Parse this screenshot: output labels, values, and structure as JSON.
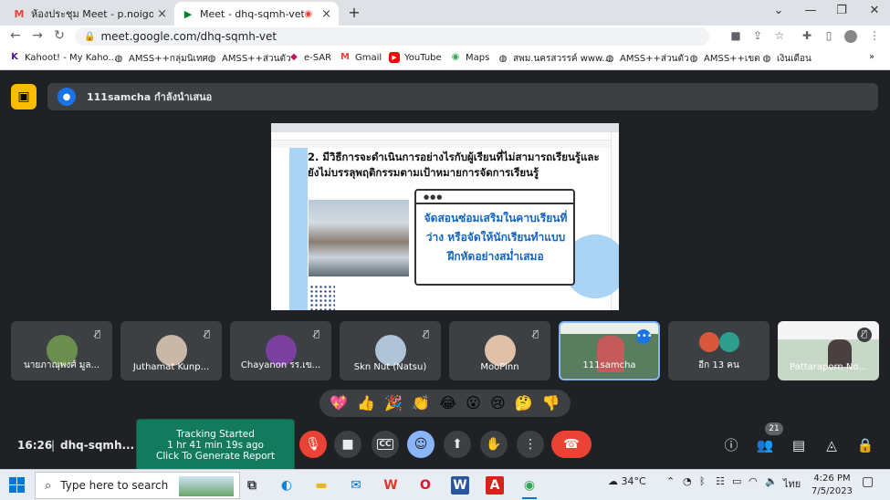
{
  "browser": {
    "tabs": [
      {
        "title": "ห้องประชุม Meet - p.noigor@gmai",
        "icon": "gmail-icon"
      },
      {
        "title": "Meet - dhq-sqmh-vet",
        "icon": "meet-icon",
        "active": true
      }
    ],
    "url": "meet.google.com/dhq-sqmh-vet",
    "bookmarks": [
      {
        "label": "Kahoot! - My Kaho...",
        "icon": "kahoot-icon"
      },
      {
        "label": "AMSS++กลุ่มนิเทศ",
        "icon": "globe-icon"
      },
      {
        "label": "AMSS++ส่วนตัว",
        "icon": "globe-icon"
      },
      {
        "label": "e-SAR",
        "icon": "esar-icon"
      },
      {
        "label": "Gmail",
        "icon": "gmail-icon"
      },
      {
        "label": "YouTube",
        "icon": "youtube-icon"
      },
      {
        "label": "Maps",
        "icon": "maps-icon"
      },
      {
        "label": "สพม.นครสวรรค์ www....",
        "icon": "globe-icon"
      },
      {
        "label": "AMSS++ส่วนตัว",
        "icon": "globe-icon"
      },
      {
        "label": "AMSS++เขต",
        "icon": "globe-icon"
      },
      {
        "label": "เงินเดือน",
        "icon": "globe-icon"
      }
    ],
    "more_bookmarks": "»"
  },
  "meet": {
    "presenter_text": "111samcha กำลังนำเสนอ",
    "slide": {
      "title": "2. มีวิธีการจะดำเนินการอย่างไรกับผู้เรียนที่ไม่สามารถเรียนรู้และยังไม่บรรลุพฤติกรรมตามเป้าหมายการจัดการเรียนรู้",
      "card_text": "จัดสอนซ่อมเสริมในคาบเรียนที่ว่าง หรือจัดให้นักเรียนทำแบบฝึกหัดอย่างสม่ำเสมอ",
      "card_dots": "●●●"
    },
    "participants": [
      {
        "name": "นายภาณุพงศ์ มูล...",
        "muted": true
      },
      {
        "name": "Juthamat Kunp...",
        "muted": true
      },
      {
        "name": "Chayanon รร.เข...",
        "muted": true
      },
      {
        "name": "Skn Nut (Natsu)",
        "muted": true
      },
      {
        "name": "MooPinn",
        "muted": true
      },
      {
        "name": "111samcha",
        "muted": false,
        "highlighted": true
      },
      {
        "name": "อีก 13 คน",
        "muted": false
      },
      {
        "name": "Pattaraporn No...",
        "muted": true
      }
    ],
    "reactions": [
      "💖",
      "👍",
      "🎉",
      "👏",
      "😂",
      "😮",
      "😢",
      "🤔",
      "👎"
    ],
    "time": "16:26",
    "separator": "|",
    "meeting_code": "dhq-sqmh...",
    "tracking": {
      "line1": "Tracking Started",
      "line2": "1 hr 41 min 19s ago",
      "line3": "Click To Generate Report"
    },
    "participant_count": "21"
  },
  "taskbar": {
    "search_placeholder": "Type here to search",
    "weather": "34°C",
    "language": "ไทย",
    "time": "4:26 PM",
    "date": "7/5/2023"
  },
  "colors": {
    "meet_bg": "#202124",
    "tile_bg": "#3c4043",
    "end_call": "#ea4335",
    "tracking_bg": "#137a5d",
    "accent_blue": "#8ab4f8"
  }
}
